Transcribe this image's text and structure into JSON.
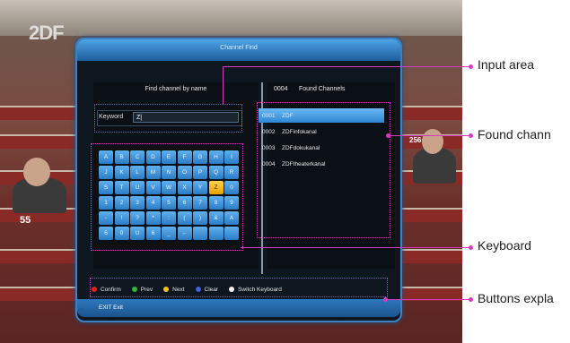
{
  "tv": {
    "logo": "2DF",
    "seat_numbers": [
      "55",
      "256"
    ]
  },
  "dialog": {
    "title": "Channel Find",
    "left_header": "Find channel by name",
    "keyword_label": "Keyword",
    "keyword_value": "Z|",
    "right_count": "0004",
    "right_header": "Found Channels",
    "keys": [
      "A",
      "B",
      "C",
      "D",
      "E",
      "F",
      "G",
      "H",
      "I",
      "J",
      "K",
      "L",
      "M",
      "N",
      "O",
      "P",
      "Q",
      "R",
      "S",
      "T",
      "U",
      "V",
      "W",
      "X",
      "Y",
      "Z",
      "0",
      "1",
      "2",
      "3",
      "4",
      "5",
      "6",
      "7",
      "8",
      "9",
      "-",
      "!",
      "?",
      "*",
      ":",
      "(",
      ")",
      "&",
      "A",
      "6",
      "0",
      "U",
      "6",
      "_",
      "←",
      "",
      "",
      " "
    ],
    "selected_key": "Z",
    "channels": [
      {
        "num": "0001",
        "name": "ZDF",
        "active": true
      },
      {
        "num": "0002",
        "name": "ZDFinfokanal",
        "active": false
      },
      {
        "num": "0003",
        "name": "ZDFdokukanal",
        "active": false
      },
      {
        "num": "0004",
        "name": "ZDFtheaterkanal",
        "active": false
      }
    ],
    "buttons": [
      {
        "label": "Confirm",
        "color": "#e02020"
      },
      {
        "label": "Prev",
        "color": "#2fb83a"
      },
      {
        "label": "Next",
        "color": "#f0c21a"
      },
      {
        "label": "Clear",
        "color": "#3a64d8"
      },
      {
        "label": "Switch Keyboard",
        "color": "#f2f2f2"
      }
    ],
    "exit_text": "EXIT Exit"
  },
  "annotations": {
    "input_area": "Input area",
    "found_channels": "Found chann",
    "keyboard": "Keyboard",
    "buttons": "Buttons expla"
  },
  "colors": {
    "accent": "#3b83c6",
    "selected_key": "#ffd24a",
    "annotation": "#d53ac0"
  }
}
